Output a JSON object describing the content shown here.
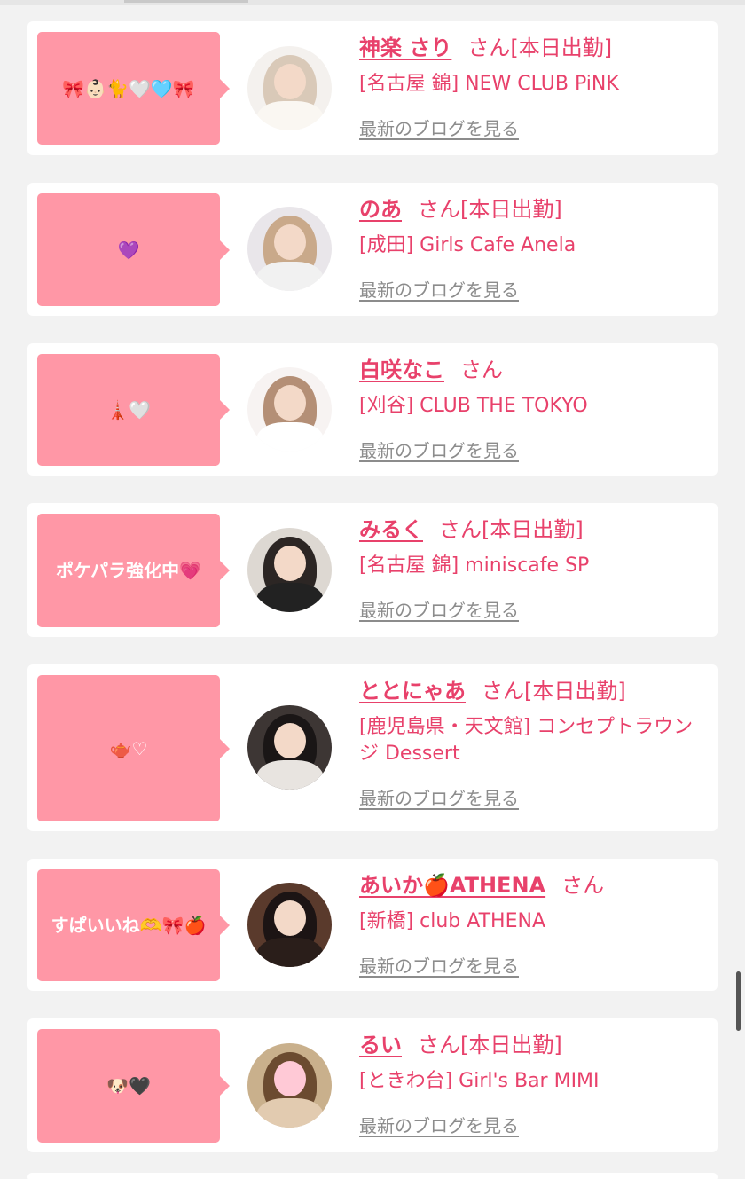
{
  "entries": [
    {
      "message": "🎀👶🏻🐈🤍🩵🎀",
      "name": "神楽 さり",
      "honorific": "さん",
      "status": "[本日出勤]",
      "shop": "[名古屋 錦] NEW CLUB PiNK",
      "blog_link": "最新のブログを見る"
    },
    {
      "message": "💜",
      "name": "のあ",
      "honorific": "さん",
      "status": "[本日出勤]",
      "shop": "[成田] Girls Cafe Anela",
      "blog_link": "最新のブログを見る"
    },
    {
      "message": "🗼🤍",
      "name": "白咲なこ",
      "honorific": "さん",
      "status": "",
      "shop": "[刈谷] CLUB THE TOKYO",
      "blog_link": "最新のブログを見る"
    },
    {
      "message": "ポケパラ強化中💗",
      "name": "みるく",
      "honorific": "さん",
      "status": "[本日出勤]",
      "shop": "[名古屋 錦] miniscafe SP",
      "blog_link": "最新のブログを見る"
    },
    {
      "message": "🫖♡",
      "name": "ととにゃあ",
      "honorific": "さん",
      "status": "[本日出勤]",
      "shop": "[鹿児島県・天文館] コンセプトラウンジ Dessert",
      "blog_link": "最新のブログを見る"
    },
    {
      "message": "すぱいいね🫶🎀🍎",
      "name": "あいか🍎ATHENA",
      "honorific": "さん",
      "status": "",
      "shop": "[新橋] club ATHENA",
      "blog_link": "最新のブログを見る"
    },
    {
      "message": "🐶🖤",
      "name": "るい",
      "honorific": "さん",
      "status": "[本日出勤]",
      "shop": "[ときわ台] Girl's Bar MIMI",
      "blog_link": "最新のブログを見る"
    }
  ],
  "colors": {
    "accent": "#e8416b",
    "bubble": "#ff97a6",
    "background": "#f2f2f2",
    "link_gray": "#8c8c8c"
  }
}
